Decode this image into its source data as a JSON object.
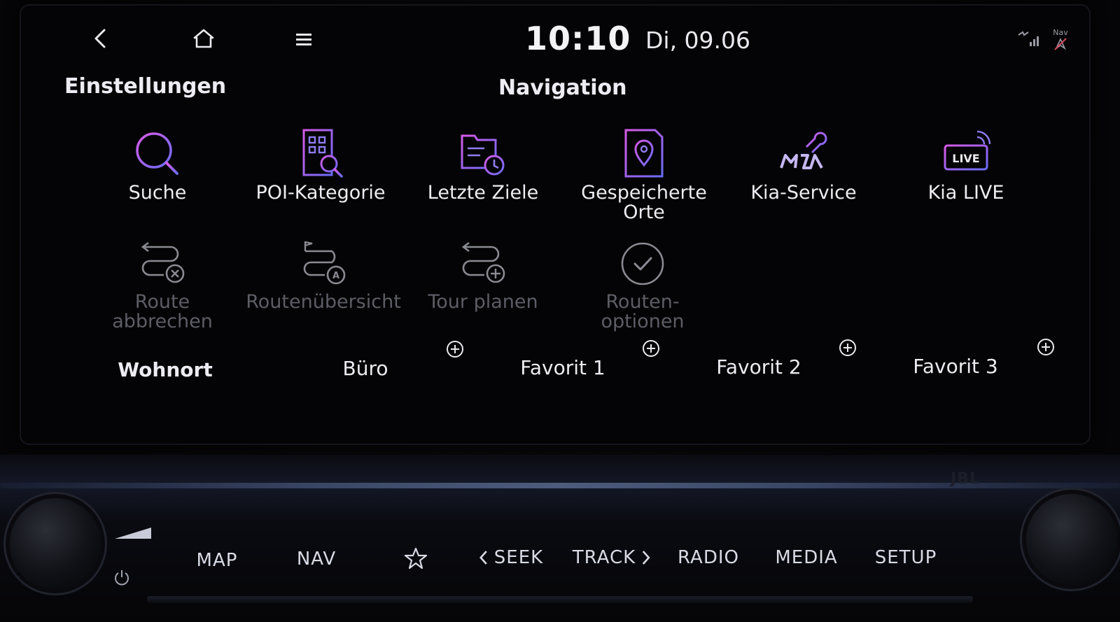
{
  "topbar": {
    "back_label": "<",
    "clock": "10:10",
    "date": "Di, 09.06",
    "nav_status_label": "Nav"
  },
  "header": {
    "left_title": "Einstellungen",
    "center_title": "Navigation"
  },
  "menu": {
    "row1": [
      {
        "label": "Suche",
        "icon": "search-icon"
      },
      {
        "label": "POI-Kategorie",
        "icon": "poi-building-icon"
      },
      {
        "label": "Letzte Ziele",
        "icon": "recent-folder-clock-icon"
      },
      {
        "label": "Gespeicherte\nOrte",
        "icon": "saved-location-pin-icon"
      },
      {
        "label": "Kia-Service",
        "icon": "kia-service-wrench-icon"
      },
      {
        "label": "Kia LIVE",
        "icon": "kia-live-icon"
      }
    ],
    "row2": [
      {
        "label": "Route\nabbrechen",
        "icon": "route-cancel-icon"
      },
      {
        "label": "Routenübersicht",
        "icon": "route-overview-icon"
      },
      {
        "label": "Tour planen",
        "icon": "tour-plan-icon"
      },
      {
        "label": "Routen-\noptionen",
        "icon": "route-options-check-icon"
      }
    ]
  },
  "favorites": [
    {
      "label": "Wohnort"
    },
    {
      "label": "Büro"
    },
    {
      "label": "Favorit 1"
    },
    {
      "label": "Favorit 2"
    },
    {
      "label": "Favorit 3"
    }
  ],
  "hardware": {
    "map": "MAP",
    "nav": "NAV",
    "seek": "SEEK",
    "track": "TRACK",
    "radio": "RADIO",
    "media": "MEDIA",
    "setup": "SETUP",
    "brand": "JBL"
  },
  "colors": {
    "accent_magenta": "#c154e8",
    "accent_blue": "#6f6cf5",
    "text": "#ececf2",
    "disabled": "#5d5d66"
  }
}
